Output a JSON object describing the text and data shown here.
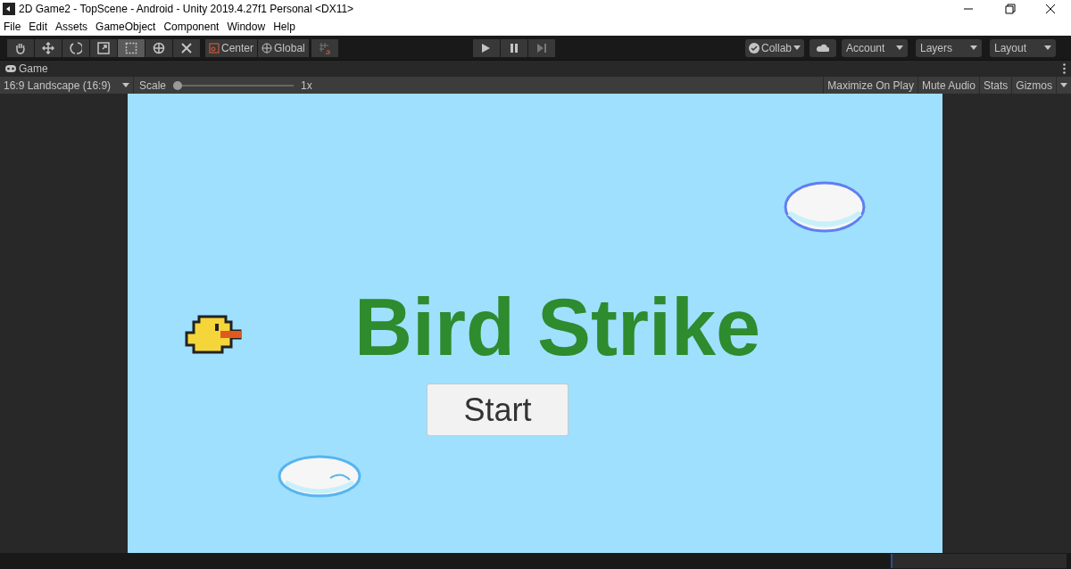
{
  "window": {
    "title": "2D Game2 - TopScene - Android - Unity 2019.4.27f1 Personal <DX11>"
  },
  "menu": [
    "File",
    "Edit",
    "Assets",
    "GameObject",
    "Component",
    "Window",
    "Help"
  ],
  "tools": [
    {
      "kind": "hand",
      "selected": false
    },
    {
      "kind": "move",
      "selected": false
    },
    {
      "kind": "rotate",
      "selected": false
    },
    {
      "kind": "scale",
      "selected": false
    },
    {
      "kind": "rect",
      "selected": true
    },
    {
      "kind": "transform",
      "selected": false
    },
    {
      "kind": "custom",
      "selected": false
    }
  ],
  "pivot_buttons": [
    "Center",
    "Global"
  ],
  "right_buttons": [
    {
      "kind": "collab",
      "label": "Collab"
    },
    {
      "kind": "cloud"
    },
    {
      "kind": "dropdown",
      "label": "Account"
    },
    {
      "kind": "dropdown",
      "label": "Layers"
    },
    {
      "kind": "dropdown",
      "label": "Layout"
    }
  ],
  "game_tab": {
    "title": "Game"
  },
  "game_toolbar": {
    "aspect": "16:9 Landscape (16:9)",
    "scale_label": "Scale",
    "scale": {
      "level": 0
    },
    "scale_reading": "1x",
    "toggles": [
      "Maximize On Play",
      "Mute Audio",
      "Stats",
      "Gizmos"
    ]
  },
  "game": {
    "title": "Bird Strike",
    "start_button": "Start"
  }
}
